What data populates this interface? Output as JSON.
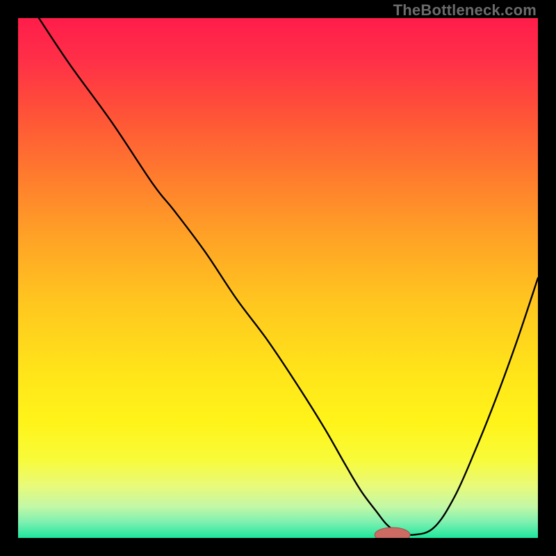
{
  "watermark": "TheBottleneck.com",
  "colors": {
    "frame": "#000000",
    "curve": "#000000",
    "gradient_stops": [
      {
        "offset": 0.0,
        "color": "#ff1d4a"
      },
      {
        "offset": 0.08,
        "color": "#ff2f48"
      },
      {
        "offset": 0.18,
        "color": "#ff5138"
      },
      {
        "offset": 0.3,
        "color": "#ff7a2e"
      },
      {
        "offset": 0.42,
        "color": "#ffa226"
      },
      {
        "offset": 0.55,
        "color": "#ffc71f"
      },
      {
        "offset": 0.68,
        "color": "#ffe41a"
      },
      {
        "offset": 0.78,
        "color": "#fff41a"
      },
      {
        "offset": 0.85,
        "color": "#f8fb3a"
      },
      {
        "offset": 0.9,
        "color": "#e8fa7a"
      },
      {
        "offset": 0.94,
        "color": "#c2f8a6"
      },
      {
        "offset": 0.97,
        "color": "#7df0b0"
      },
      {
        "offset": 1.0,
        "color": "#1de79c"
      }
    ],
    "marker_fill": "#cb6b64",
    "marker_stroke": "#a94f49"
  },
  "chart_data": {
    "type": "line",
    "title": "",
    "xlabel": "",
    "ylabel": "",
    "xlim": [
      0,
      100
    ],
    "ylim": [
      0,
      100
    ],
    "x": [
      4,
      10,
      18,
      26,
      30,
      36,
      42,
      48,
      54,
      59,
      63,
      66,
      69,
      71,
      73,
      76,
      80,
      84,
      88,
      92,
      96,
      100
    ],
    "values": [
      100,
      91,
      80,
      68,
      63,
      55,
      46,
      38,
      29,
      21,
      14,
      9,
      5,
      2.5,
      1.2,
      0.6,
      2,
      8,
      17,
      27,
      38,
      50
    ],
    "marker": {
      "x": 72,
      "y": 0.6,
      "rx": 3.4,
      "ry": 1.4
    }
  }
}
